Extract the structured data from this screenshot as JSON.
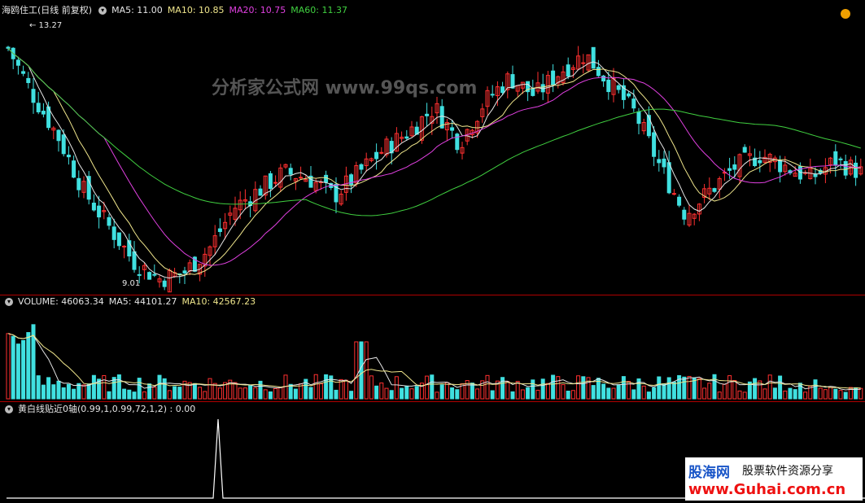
{
  "header": {
    "title": "海鸥住工(日线 前复权)",
    "ma": [
      {
        "label": "MA5: 11.00",
        "color": "#e6e6e6"
      },
      {
        "label": "MA10: 10.85",
        "color": "#f0e68c"
      },
      {
        "label": "MA20: 10.75",
        "color": "#e040e0"
      },
      {
        "label": "MA60: 11.37",
        "color": "#40d040"
      }
    ]
  },
  "price_panel": {
    "high_label": "13.27",
    "low_label": "9.01",
    "watermark": "分析家公式网 www.99qs.com"
  },
  "volume_panel": {
    "label": "VOLUME: 46063.34",
    "ma5": "MA5: 44101.27",
    "ma10": "MA10: 42567.23"
  },
  "indicator_panel": {
    "label": "黄白线贴近0轴(0.99,1,0.99,72,1,2)  : 0.00"
  },
  "logo": {
    "line1": "股海网",
    "line1b": "股票软件资源分享",
    "line2": "www.Guhai.com.cn"
  },
  "colors": {
    "up": "#ff3030",
    "down": "#40e0e0",
    "ma5": "#e6e6e6",
    "ma10": "#f0e68c",
    "ma20": "#e040e0",
    "ma60": "#40d040"
  },
  "chart_data": {
    "type": "line",
    "title": "海鸥住工(日线 前复权)",
    "y_range": [
      9.01,
      13.27
    ],
    "series": [
      {
        "name": "MA5",
        "last": 11.0
      },
      {
        "name": "MA10",
        "last": 10.85
      },
      {
        "name": "MA20",
        "last": 10.75
      },
      {
        "name": "MA60",
        "last": 11.37
      }
    ],
    "volume": {
      "last": 46063.34,
      "ma5": 44101.27,
      "ma10": 42567.23
    },
    "indicator": {
      "name": "黄白线贴近0轴",
      "params": "0.99,1,0.99,72,1,2",
      "value": 0.0
    }
  }
}
